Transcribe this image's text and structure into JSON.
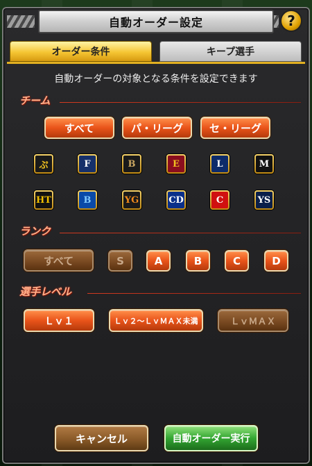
{
  "header": {
    "title": "自動オーダー設定",
    "help_label": "?"
  },
  "tabs": [
    {
      "label": "オーダー条件",
      "active": true
    },
    {
      "label": "キープ選手",
      "active": false
    }
  ],
  "description": "自動オーダーの対象となる条件を設定できます",
  "team_section": {
    "title": "チーム",
    "filters": [
      "すべて",
      "パ・リーグ",
      "セ・リーグ"
    ],
    "teams_row1": [
      {
        "icon": "hawks-logo-icon",
        "glyph": "ぷ",
        "bg": "#1a1a1a",
        "fg": "#f0c020"
      },
      {
        "icon": "fighters-logo-icon",
        "glyph": "F",
        "bg": "#16306a",
        "fg": "#ffffff"
      },
      {
        "icon": "buffaloes-logo-icon",
        "glyph": "B",
        "bg": "#1a1a1a",
        "fg": "#c8a560"
      },
      {
        "icon": "eagles-logo-icon",
        "glyph": "E",
        "bg": "#8a0e1e",
        "fg": "#f0c020"
      },
      {
        "icon": "lions-logo-icon",
        "glyph": "L",
        "bg": "#0d2b6a",
        "fg": "#ffffff"
      },
      {
        "icon": "marines-logo-icon",
        "glyph": "M",
        "bg": "#111111",
        "fg": "#ffffff"
      }
    ],
    "teams_row2": [
      {
        "icon": "tigers-logo-icon",
        "glyph": "HT",
        "bg": "#111111",
        "fg": "#f2c000"
      },
      {
        "icon": "baystars-logo-icon",
        "glyph": "B",
        "bg": "#0a4aa8",
        "fg": "#7fc8ff"
      },
      {
        "icon": "giants-logo-icon",
        "glyph": "YG",
        "bg": "#1a1a1a",
        "fg": "#f18a1c"
      },
      {
        "icon": "dragons-logo-icon",
        "glyph": "CD",
        "bg": "#0a2f8a",
        "fg": "#ffffff"
      },
      {
        "icon": "carp-logo-icon",
        "glyph": "C",
        "bg": "#d01010",
        "fg": "#ffffff"
      },
      {
        "icon": "swallows-logo-icon",
        "glyph": "YS",
        "bg": "#0a1f4a",
        "fg": "#ffffff"
      }
    ]
  },
  "rank_section": {
    "title": "ランク",
    "options": [
      "すべて",
      "S",
      "A",
      "B",
      "C",
      "D"
    ]
  },
  "level_section": {
    "title": "選手レベル",
    "options": [
      "Ｌｖ１",
      "Ｌｖ２～ＬｖＭＡＸ未満",
      "ＬｖＭＡＸ"
    ]
  },
  "footer": {
    "cancel_label": "キャンセル",
    "execute_label": "自動オーダー実行"
  }
}
